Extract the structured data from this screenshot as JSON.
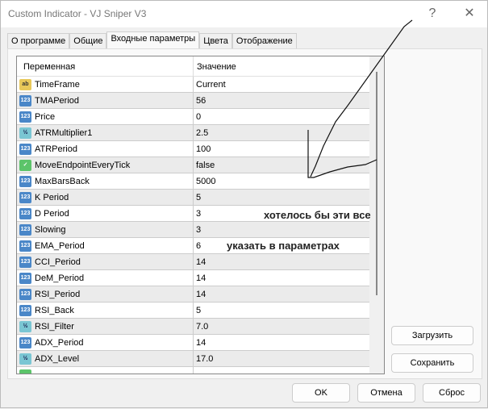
{
  "window": {
    "title": "Custom Indicator - VJ Sniper V3",
    "help": "?",
    "close": "✕"
  },
  "tabs": [
    "О программе",
    "Общие",
    "Входные параметры",
    "Цвета",
    "Отображение"
  ],
  "columns": {
    "name": "Переменная",
    "value": "Значение"
  },
  "rows": [
    {
      "type": "str",
      "icon": "ab",
      "name": "TimeFrame",
      "value": "Current"
    },
    {
      "type": "int",
      "icon": "123",
      "name": "TMAPeriod",
      "value": "56"
    },
    {
      "type": "int",
      "icon": "123",
      "name": "Price",
      "value": "0"
    },
    {
      "type": "dbl",
      "icon": "½",
      "name": "ATRMultiplier1",
      "value": "2.5"
    },
    {
      "type": "int",
      "icon": "123",
      "name": "ATRPeriod",
      "value": "100"
    },
    {
      "type": "bool",
      "icon": "✓",
      "name": "MoveEndpointEveryTick",
      "value": "false"
    },
    {
      "type": "int",
      "icon": "123",
      "name": "MaxBarsBack",
      "value": "5000"
    },
    {
      "type": "int",
      "icon": "123",
      "name": "K Period",
      "value": "5"
    },
    {
      "type": "int",
      "icon": "123",
      "name": "D Period",
      "value": "3"
    },
    {
      "type": "int",
      "icon": "123",
      "name": "Slowing",
      "value": "3"
    },
    {
      "type": "int",
      "icon": "123",
      "name": "EMA_Period",
      "value": "6"
    },
    {
      "type": "int",
      "icon": "123",
      "name": "CCI_Period",
      "value": "14"
    },
    {
      "type": "int",
      "icon": "123",
      "name": "DeM_Period",
      "value": "14"
    },
    {
      "type": "int",
      "icon": "123",
      "name": "RSI_Period",
      "value": "14"
    },
    {
      "type": "int",
      "icon": "123",
      "name": "RSI_Back",
      "value": "5"
    },
    {
      "type": "dbl",
      "icon": "½",
      "name": "RSI_Filter",
      "value": "7.0"
    },
    {
      "type": "int",
      "icon": "123",
      "name": "ADX_Period",
      "value": "14"
    },
    {
      "type": "dbl",
      "icon": "½",
      "name": "ADX_Level",
      "value": "17.0"
    },
    {
      "type": "bool",
      "icon": "",
      "name": "",
      "value": ""
    }
  ],
  "annotations": {
    "line1": "хотелось бы эти все",
    "line2": "указать в параметрах"
  },
  "buttons": {
    "load": "Загрузить",
    "save": "Сохранить",
    "ok": "OK",
    "cancel": "Отмена",
    "reset": "Сброс"
  }
}
